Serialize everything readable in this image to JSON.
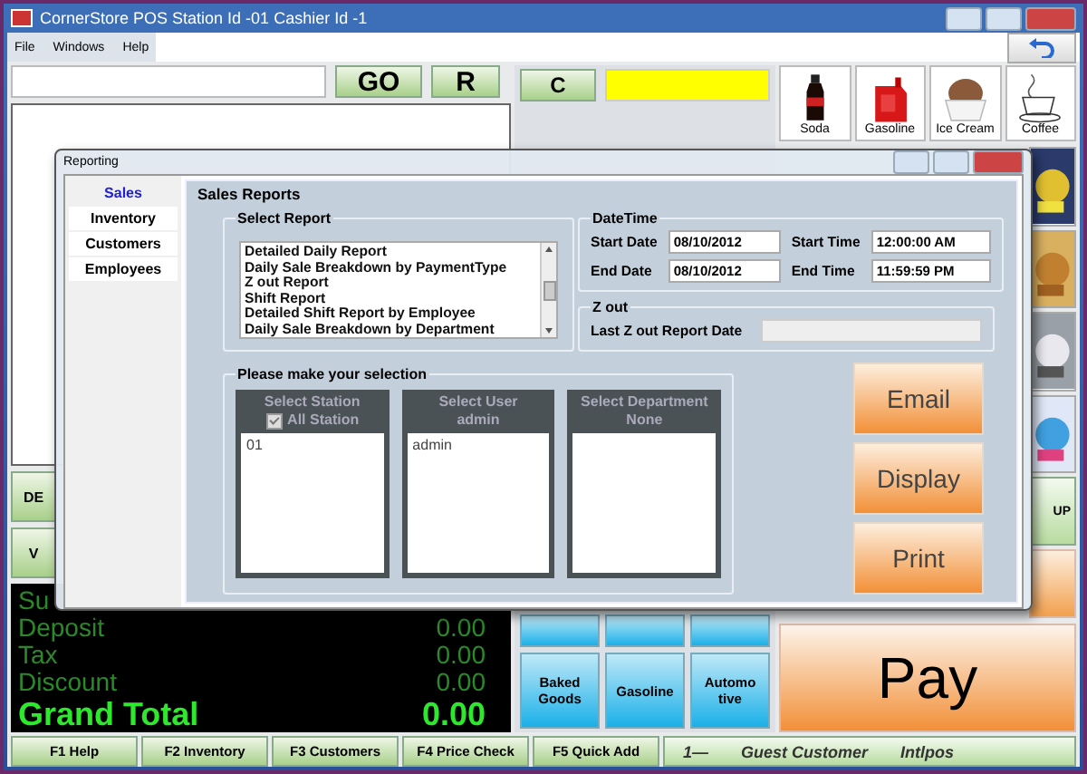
{
  "window": {
    "title": "CornerStore POS Station Id -01 Cashier Id -1"
  },
  "menu": [
    "File",
    "Windows",
    "Help"
  ],
  "scan": {
    "go": "GO",
    "reset": "R"
  },
  "keypad": {
    "clear": "C"
  },
  "products": [
    {
      "label": "Soda",
      "kind": "soda"
    },
    {
      "label": "Gasoline",
      "kind": "gas"
    },
    {
      "label": "Ice Cream",
      "kind": "icecream"
    },
    {
      "label": "Coffee",
      "kind": "coffee"
    }
  ],
  "side_buttons": [
    "DE",
    "V"
  ],
  "totals": [
    {
      "label": "Su"
    },
    {
      "label": "Deposit",
      "value": "0.00"
    },
    {
      "label": "Tax",
      "value": "0.00"
    },
    {
      "label": "Discount",
      "value": "0.00"
    }
  ],
  "grand_total": {
    "label": "Grand Total",
    "value": "0.00"
  },
  "categories": [
    "Baked Goods",
    "Gasoline",
    "Automo tive"
  ],
  "strip_button": "UP",
  "pay": "Pay",
  "function_keys": [
    "F1 Help",
    "F2 Inventory",
    "F3 Customers",
    "F4 Price Check",
    "F5 Quick Add"
  ],
  "status": {
    "number": "1—",
    "customer": "Guest Customer",
    "user": "Intlpos"
  },
  "reporting": {
    "title": "Reporting",
    "tabs": [
      {
        "label": "Sales",
        "selected": true
      },
      {
        "label": "Inventory",
        "selected": false
      },
      {
        "label": "Customers",
        "selected": false
      },
      {
        "label": "Employees",
        "selected": false
      }
    ],
    "section": "Sales Reports",
    "select_report": {
      "title": "Select Report",
      "items": [
        "Detailed Daily Report",
        "Daily Sale Breakdown by PaymentType",
        "Z out Report",
        "Shift Report",
        "Detailed Shift Report by Employee",
        "Daily Sale Breakdown by Department"
      ]
    },
    "datetime": {
      "title": "DateTime",
      "start_date": {
        "label": "Start Date",
        "value": "08/10/2012"
      },
      "end_date": {
        "label": "End Date",
        "value": "08/10/2012"
      },
      "start_time": {
        "label": "Start Time",
        "value": "12:00:00 AM"
      },
      "end_time": {
        "label": "End Time",
        "value": "11:59:59 PM"
      }
    },
    "zout": {
      "title": "Z out",
      "label": "Last Z out Report Date"
    },
    "selection": {
      "title": "Please make your selection",
      "panels": [
        {
          "title": "Select Station",
          "option": {
            "label": "All Station",
            "checked": true
          },
          "items": [
            "01"
          ]
        },
        {
          "title": "Select User",
          "subtitle": "admin",
          "items": [
            "admin"
          ]
        },
        {
          "title": "Select Department",
          "subtitle": "None"
        }
      ]
    },
    "buttons": [
      "Email",
      "Display",
      "Print"
    ]
  }
}
